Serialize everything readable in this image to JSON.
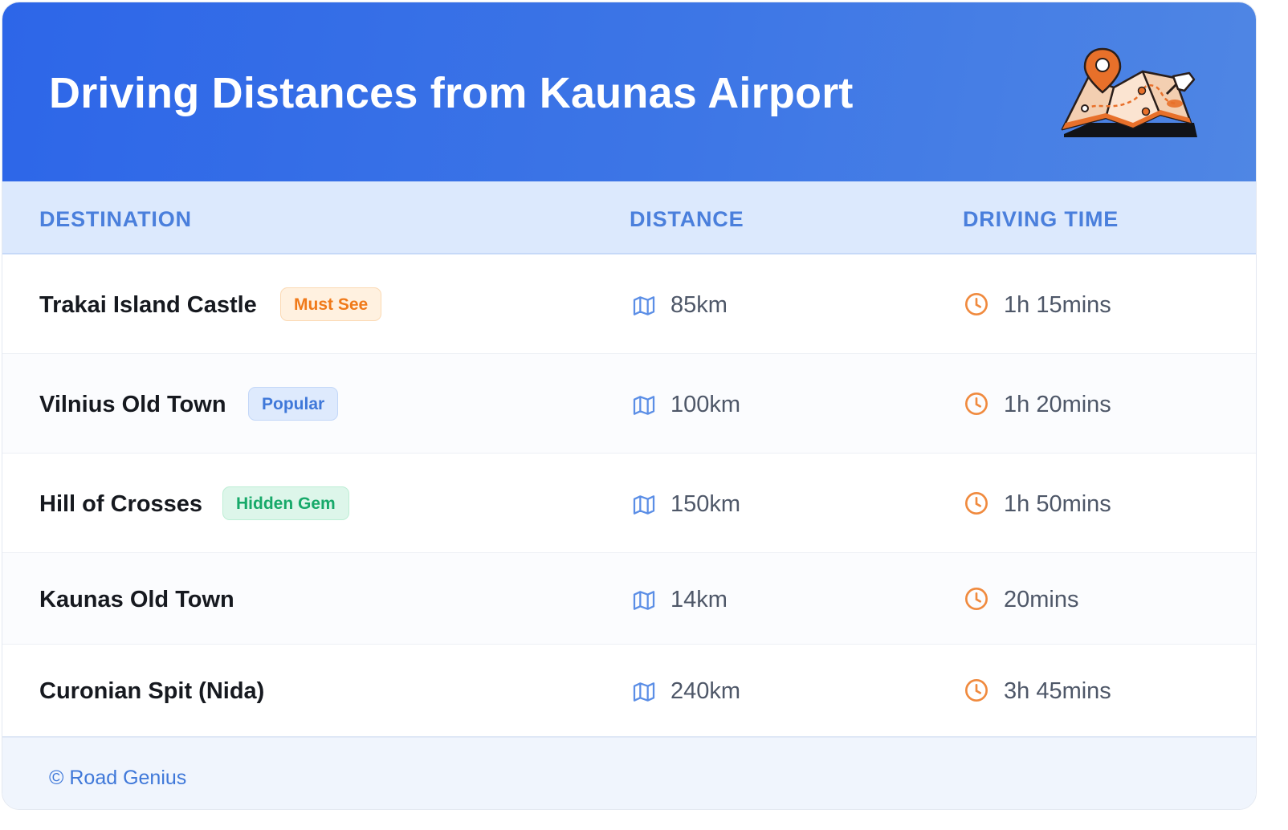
{
  "header": {
    "title": "Driving Distances from Kaunas Airport",
    "illustration_icon": "folded-map-with-pins-icon"
  },
  "columns": {
    "destination": "DESTINATION",
    "distance": "DISTANCE",
    "driving_time": "DRIVING TIME"
  },
  "rows": [
    {
      "destination": "Trakai Island Castle",
      "badge": "Must See",
      "badge_color": "#f07a1a",
      "distance": "85km",
      "time": "1h 15mins"
    },
    {
      "destination": "Vilnius Old Town",
      "badge": "Popular",
      "badge_color": "#3f78d9",
      "distance": "100km",
      "time": "1h 20mins"
    },
    {
      "destination": "Hill of Crosses",
      "badge": "Hidden Gem",
      "badge_color": "#17a96a",
      "distance": "150km",
      "time": "1h 50mins"
    },
    {
      "destination": "Kaunas Old Town",
      "badge": "",
      "distance": "14km",
      "time": "20mins"
    },
    {
      "destination": "Curonian Spit (Nida)",
      "badge": "",
      "distance": "240km",
      "time": "3h 45mins"
    }
  ],
  "icons": {
    "distance": "map-icon",
    "time": "clock-icon"
  },
  "footer": {
    "copyright": "© Road Genius"
  },
  "colors": {
    "header_start": "#2d66e8",
    "header_end": "#4f86e4",
    "column_header_bg": "#dce9fd",
    "accent_blue": "#4a7fdc",
    "accent_orange": "#f08a3e"
  }
}
